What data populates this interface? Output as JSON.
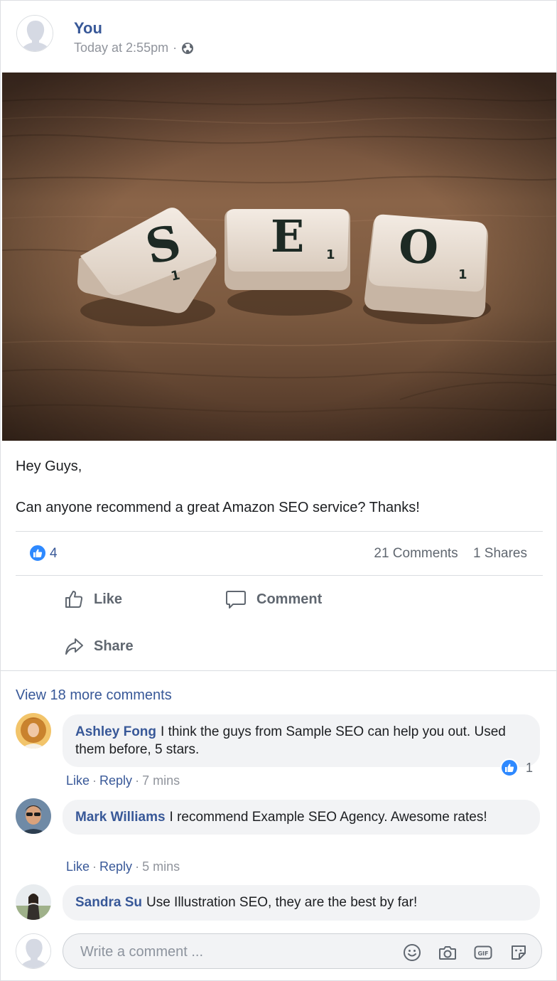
{
  "post": {
    "author": "You",
    "timestamp": "Today at 2:55pm",
    "separator": "·",
    "privacy_icon": "globe-icon",
    "photo_tiles": [
      "S",
      "E",
      "O"
    ],
    "photo_tile_points": [
      "1",
      "1",
      "1"
    ],
    "text_line1": "Hey Guys,",
    "text_line2": "Can anyone recommend a great Amazon SEO service? Thanks!",
    "like_count": "4",
    "comments_count": "21 Comments",
    "shares_count": "1 Shares"
  },
  "actions": {
    "like": "Like",
    "comment": "Comment",
    "share": "Share"
  },
  "comments_section": {
    "view_more": "View 18 more comments",
    "comments": [
      {
        "name": "Ashley Fong",
        "text": "I think the guys from Sample SEO can help you out. Used them before, 5 stars.",
        "like_label": "Like",
        "reply_label": "Reply",
        "time": "7 mins",
        "reactions": "1"
      },
      {
        "name": "Mark Williams",
        "text": "I recommend Example SEO Agency. Awesome rates!",
        "like_label": "Like",
        "reply_label": "Reply",
        "time": "5 mins"
      },
      {
        "name": "Sandra Su",
        "text": "Use Illustration SEO, they are the best by far!"
      }
    ],
    "dot": "·"
  },
  "composer": {
    "placeholder": "Write a comment ...",
    "tools": [
      "emoji-icon",
      "camera-icon",
      "gif-icon",
      "sticker-icon"
    ]
  },
  "colors": {
    "link_blue": "#385898",
    "like_blue": "#2e89ff",
    "muted_gray": "#90949c",
    "bubble_bg": "#f2f3f5"
  }
}
